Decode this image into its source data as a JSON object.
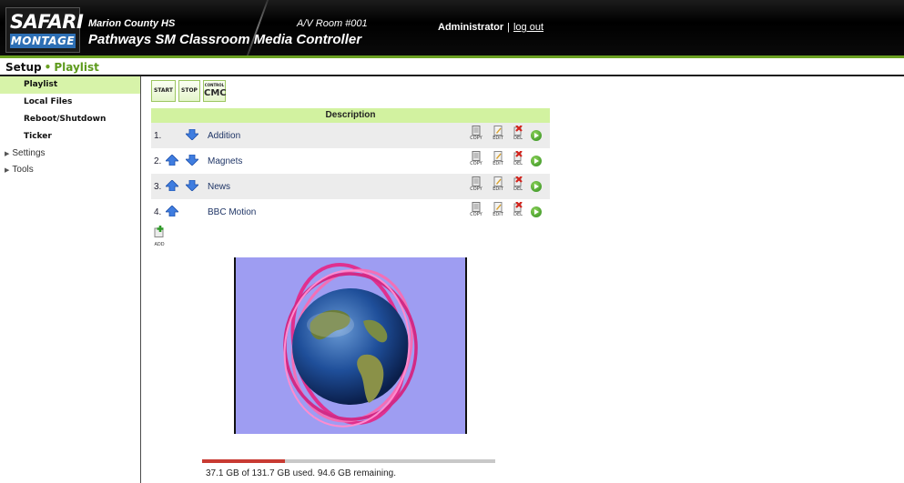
{
  "header": {
    "logo_top": "SAFARI",
    "logo_bottom": "MONTAGE",
    "school": "Marion County HS",
    "room": "A/V Room #001",
    "app_title": "Pathways SM Classroom Media Controller",
    "user": "Administrator",
    "separator": "|",
    "logout": "log out"
  },
  "breadcrumb": {
    "root": "Setup",
    "dot": "•",
    "current": "Playlist"
  },
  "sidebar": {
    "items": [
      {
        "label": "Playlist"
      },
      {
        "label": "Local Files"
      },
      {
        "label": "Reboot/Shutdown"
      },
      {
        "label": "Ticker"
      }
    ],
    "groups": [
      {
        "label": "Settings"
      },
      {
        "label": "Tools"
      }
    ]
  },
  "toolbar": {
    "start_label": "START",
    "stop_label": "STOP",
    "control_label": "CONTROL",
    "cmc_label": "CMC"
  },
  "playlist": {
    "header": "Description",
    "copy_label": "COPY",
    "edit_label": "EDIT",
    "del_label": "DEL",
    "add_label": "ADD",
    "rows": [
      {
        "num": "1.",
        "title": "Addition"
      },
      {
        "num": "2.",
        "title": "Magnets"
      },
      {
        "num": "3.",
        "title": "News"
      },
      {
        "num": "4.",
        "title": "BBC Motion"
      }
    ]
  },
  "storage": {
    "used_fraction": 0.282,
    "text": "37.1 GB of 131.7 GB used. 94.6 GB remaining."
  },
  "colors": {
    "accent_green": "#6aa022",
    "header_bg": "#000000",
    "logo_blue": "#2d6fb5",
    "table_header_bg": "#d2f2a0",
    "sidebar_active_bg": "#d7f3a9",
    "video_bg": "#9e9df2",
    "storage_used": "#c83a32"
  }
}
